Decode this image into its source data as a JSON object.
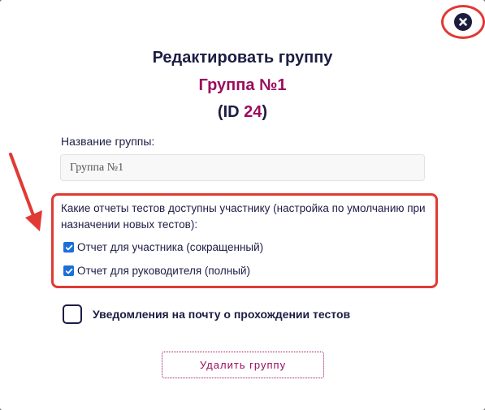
{
  "modal": {
    "title": "Редактировать группу",
    "group_name": "Группа №1",
    "id_open": "(ID ",
    "id_value": "24",
    "id_close": ")"
  },
  "name_field": {
    "label": "Название группы:",
    "value": "Группа №1"
  },
  "reports": {
    "title": "Какие отчеты тестов доступны участнику (настройка по умолчанию при назначении новых тестов):",
    "options": [
      {
        "label": "Отчет для участника (сокращенный)",
        "checked": true
      },
      {
        "label": "Отчет для руководителя (полный)",
        "checked": true
      }
    ]
  },
  "notifications": {
    "label": "Уведомления на почту о прохождении тестов",
    "checked": false
  },
  "delete_button": {
    "label": "Удалить группу"
  },
  "icons": {
    "close": "close-icon",
    "arrow": "annotation-arrow-icon"
  },
  "colors": {
    "accent": "#9b0d5e",
    "text": "#1c1c44",
    "annotation": "#e03a33",
    "checkbox": "#1a6fd8"
  }
}
